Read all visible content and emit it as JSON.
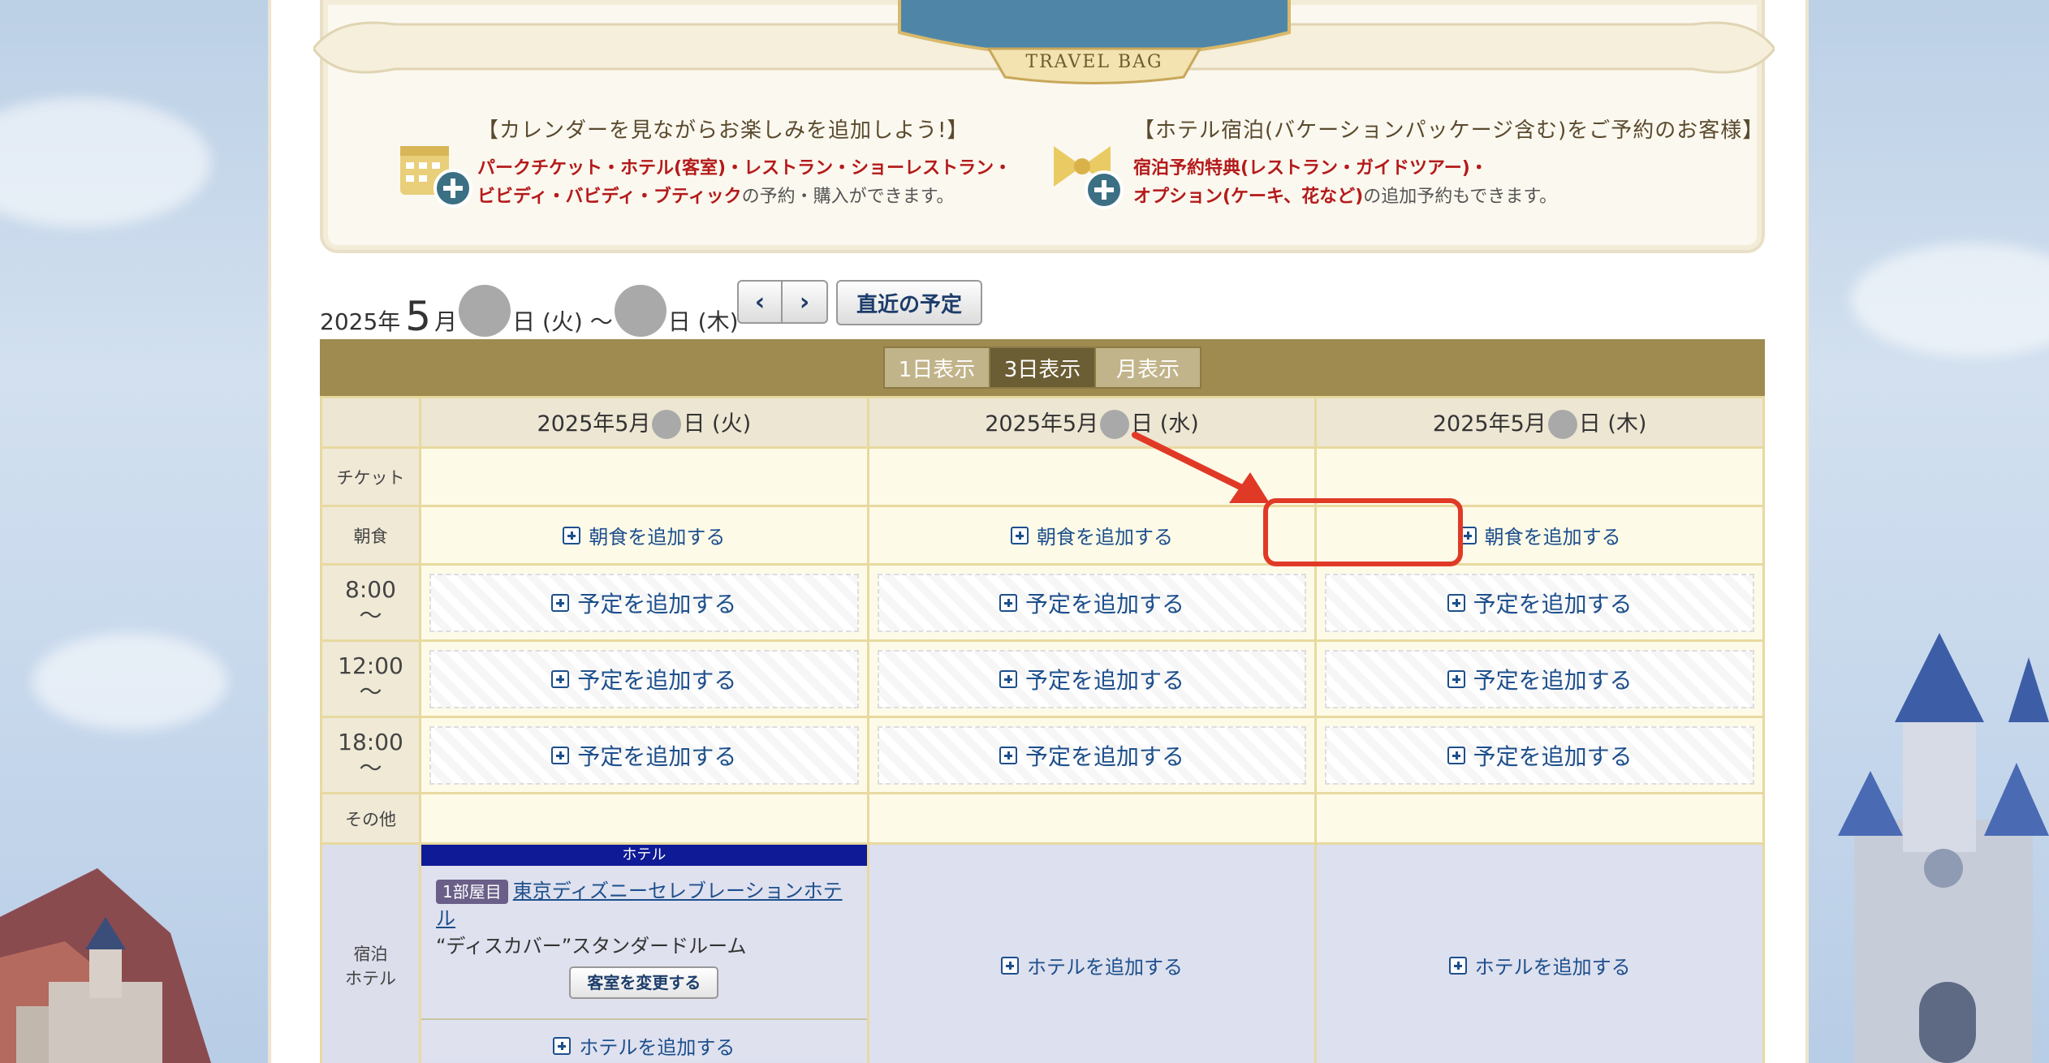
{
  "banner": {
    "title_en": "TRAVEL BAG",
    "left_head": "【カレンダーを見ながらお楽しみを追加しよう!】",
    "left_line1": "パークチケット・ホテル(客室)・レストラン・ショーレストラン・",
    "left_line2_red": "ビビディ・バビディ・ブティック",
    "left_line2_rest": "の予約・購入ができます。",
    "right_head": "【ホテル宿泊(バケーションパッケージ含む)をご予約のお客様】",
    "right_line1": "宿泊予約特典(レストラン・ガイドツアー)・",
    "right_line2_red": "オプション(ケーキ、花など)",
    "right_line2_rest": "の追加予約もできます。"
  },
  "date_range": {
    "year": "2025年",
    "month": "5",
    "month_suffix": "月",
    "start_suffix": "日 (火) 〜",
    "end_suffix": "日 (木)"
  },
  "nav": {
    "prev": "‹",
    "next": "›",
    "recent": "直近の予定"
  },
  "view_tabs": [
    "1日表示",
    "3日表示",
    "月表示"
  ],
  "columns": [
    {
      "prefix": "2025年5月",
      "suffix": "日 (火)"
    },
    {
      "prefix": "2025年5月",
      "suffix": "日 (水)"
    },
    {
      "prefix": "2025年5月",
      "suffix": "日 (木)"
    }
  ],
  "rows": {
    "ticket": "チケット",
    "breakfast": "朝食",
    "breakfast_add": "朝食を追加する",
    "time_8": "8:00",
    "time_12": "12:00",
    "time_18": "18:00",
    "time_tilde": "〜",
    "add_plan": "予定を追加する",
    "other": "その他",
    "hotel_line1": "宿泊",
    "hotel_line2": "ホテル"
  },
  "hotel": {
    "strip": "ホテル",
    "room_tag": "1部屋目",
    "name": "東京ディズニーセレブレーションホテル",
    "room_type": "“ディスカバー”スタンダードルーム",
    "change_btn": "客室を変更する",
    "add_hotel": "ホテルを追加する"
  },
  "colors": {
    "accent_red": "#e03a27",
    "link_blue": "#1d4f8c",
    "header_gold": "#9f8b50"
  }
}
